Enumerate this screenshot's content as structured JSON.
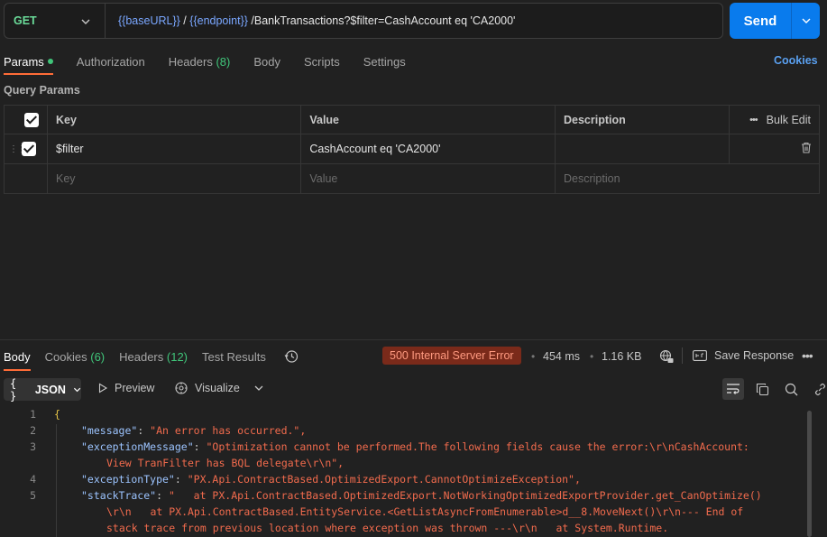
{
  "request": {
    "method": "GET",
    "url_parts": {
      "base_var": "{{baseURL}}",
      "slash1": "/",
      "endpoint_var": "{{endpoint}}",
      "path": "/BankTransactions?$filter=CashAccount eq 'CA2000'"
    },
    "send_label": "Send"
  },
  "request_tabs": {
    "params": "Params",
    "authorization": "Authorization",
    "headers": "Headers",
    "headers_count": "(8)",
    "body": "Body",
    "scripts": "Scripts",
    "settings": "Settings",
    "cookies": "Cookies"
  },
  "query_params": {
    "title": "Query Params",
    "headers": {
      "key": "Key",
      "value": "Value",
      "description": "Description",
      "bulk_edit": "Bulk Edit"
    },
    "rows": [
      {
        "key": "$filter",
        "value": "CashAccount eq 'CA2000'",
        "description": "",
        "checked": true
      }
    ],
    "placeholders": {
      "key": "Key",
      "value": "Value",
      "description": "Description"
    }
  },
  "response_tabs": {
    "body": "Body",
    "cookies": "Cookies",
    "cookies_count": "(6)",
    "headers": "Headers",
    "headers_count": "(12)",
    "test_results": "Test Results"
  },
  "response_meta": {
    "status": "500 Internal Server Error",
    "time": "454 ms",
    "size": "1.16 KB",
    "save_response": "Save Response"
  },
  "response_toolbar": {
    "format": "JSON",
    "preview": "Preview",
    "visualize": "Visualize"
  },
  "response_body": {
    "lines": [
      {
        "n": "1",
        "text": "{"
      },
      {
        "n": "2",
        "key": "\"message\"",
        "value": "\"An error has occurred.\","
      },
      {
        "n": "3",
        "key": "\"exceptionMessage\"",
        "value": "\"Optimization cannot be performed.The following fields cause the error:\\r\\nCashAccount:",
        "cont": "View TranFilter has BQL delegate\\r\\n\","
      },
      {
        "n": "4",
        "key": "\"exceptionType\"",
        "value": "\"PX.Api.ContractBased.OptimizedExport.CannotOptimizeException\","
      },
      {
        "n": "5",
        "key": "\"stackTrace\"",
        "value": "\"   at PX.Api.ContractBased.OptimizedExport.NotWorkingOptimizedExportProvider.get_CanOptimize()",
        "cont": "\\r\\n   at PX.Api.ContractBased.EntityService.<GetListAsyncFromEnumerable>d__8.MoveNext()\\r\\n--- End of",
        "cont2": "stack trace from previous location where exception was thrown ---\\r\\n   at System.Runtime."
      }
    ]
  },
  "colors": {
    "accent_send": "#097bed",
    "method_get": "#6bdd9a",
    "status_error_bg": "#7a2a1a",
    "active_tab_underline": "#ff6c37"
  },
  "icons": [
    "chevron-down-icon",
    "checkbox-icon",
    "drag-handle-icon",
    "trash-icon",
    "more-icon",
    "history-icon",
    "globe-lock-icon",
    "save-response-icon",
    "play-icon",
    "visualize-icon",
    "wrap-icon",
    "copy-icon",
    "search-icon",
    "link-icon"
  ]
}
